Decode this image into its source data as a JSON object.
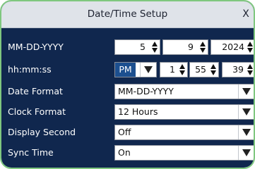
{
  "dialog": {
    "title": "Date/Time Setup",
    "close_label": "X"
  },
  "rows": {
    "date": {
      "label": "MM-DD-YYYY",
      "month": "5",
      "day": "9",
      "year": "2024"
    },
    "time": {
      "label": "hh:mm:ss",
      "ampm": "PM",
      "hour": "1",
      "minute": "55",
      "second": "39"
    },
    "date_format": {
      "label": "Date Format",
      "value": "MM-DD-YYYY"
    },
    "clock_format": {
      "label": "Clock Format",
      "value": "12 Hours"
    },
    "display_second": {
      "label": "Display Second",
      "value": "Off"
    },
    "sync_time": {
      "label": "Sync Time",
      "value": "On"
    }
  },
  "colors": {
    "panel": "#10274e",
    "titlebar": "#dfe3e9",
    "selection": "#1c4f8f",
    "bezel": "#7fc77f"
  }
}
